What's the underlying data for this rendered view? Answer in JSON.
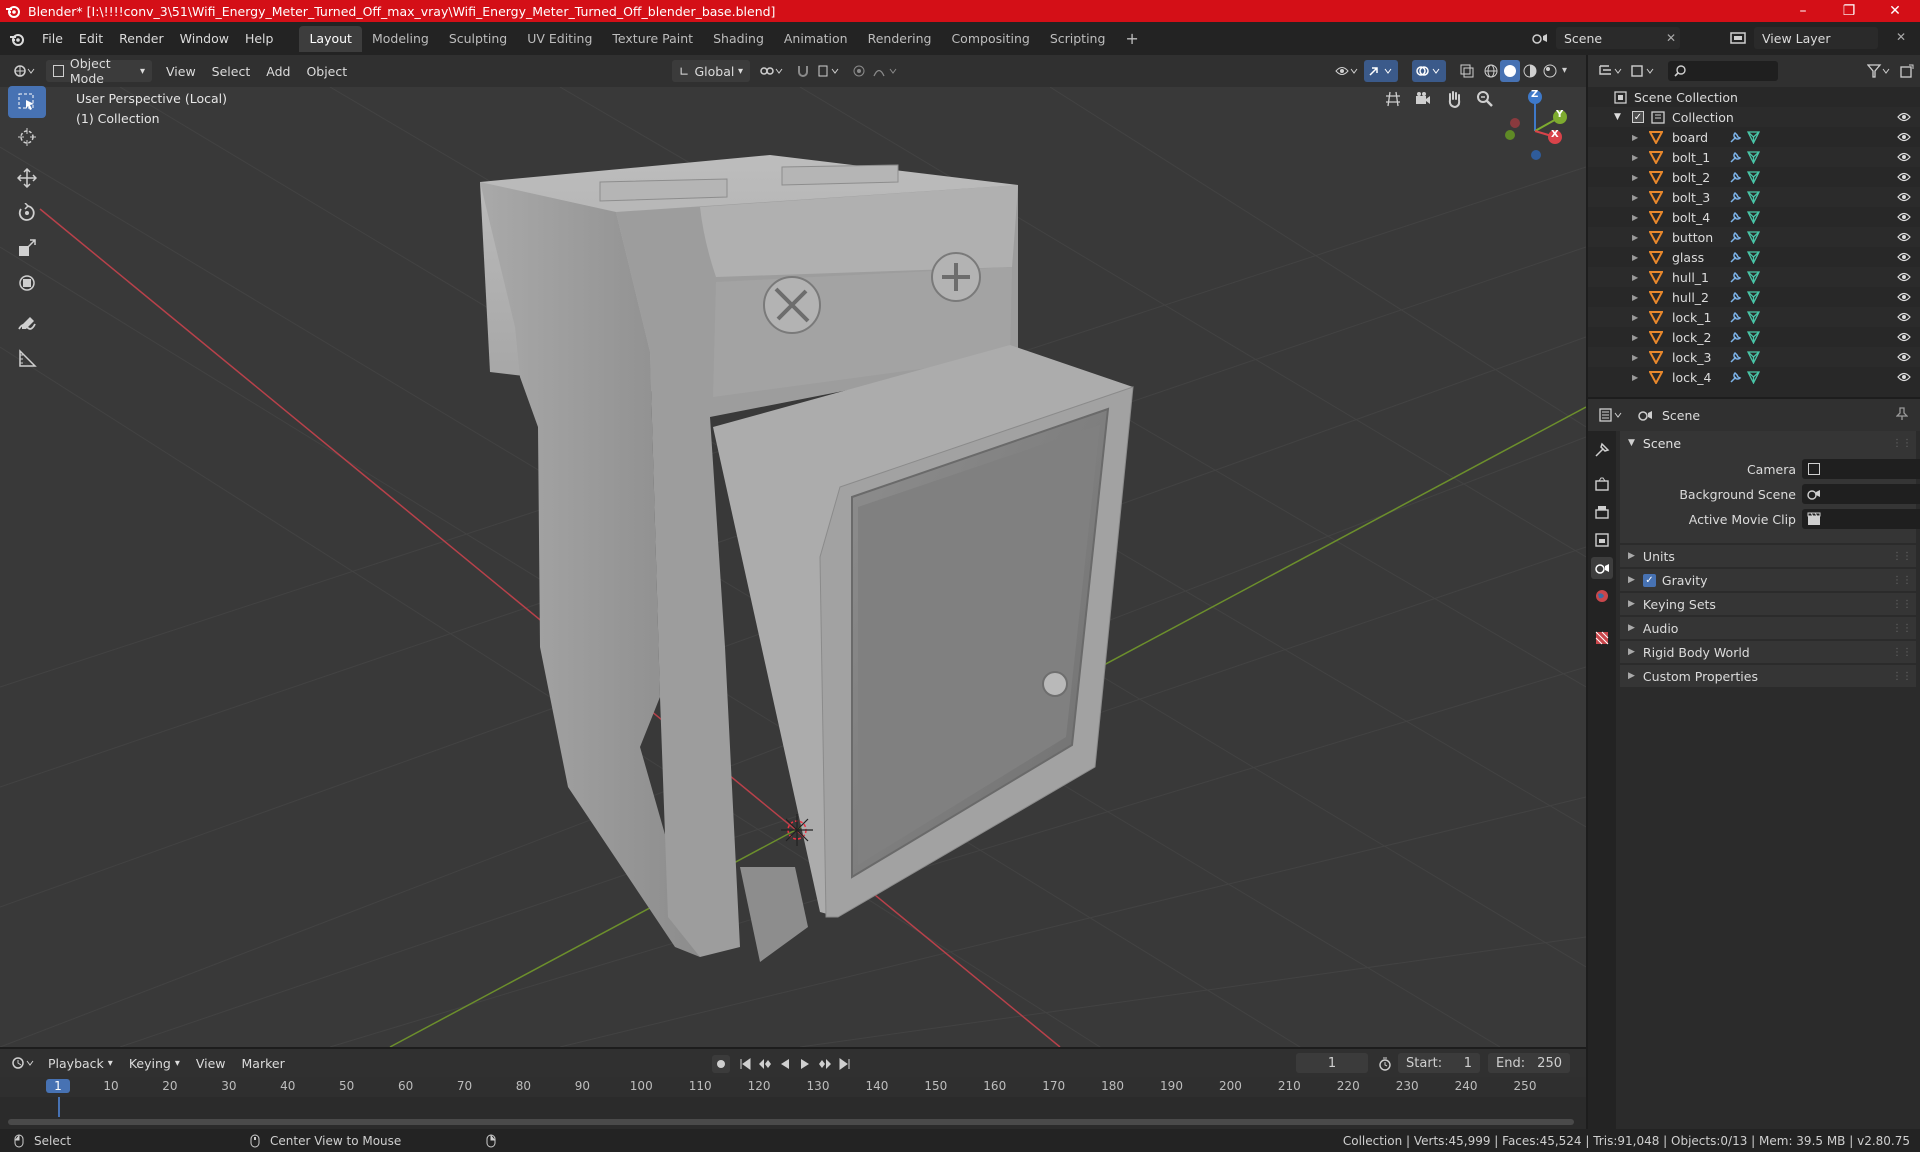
{
  "window": {
    "title": "Blender* [I:\\!!!!conv_3\\51\\Wifi_Energy_Meter_Turned_Off_max_vray\\Wifi_Energy_Meter_Turned_Off_blender_base.blend]"
  },
  "menu": [
    "File",
    "Edit",
    "Render",
    "Window",
    "Help"
  ],
  "workspaces": [
    "Layout",
    "Modeling",
    "Sculpting",
    "UV Editing",
    "Texture Paint",
    "Shading",
    "Animation",
    "Rendering",
    "Compositing",
    "Scripting"
  ],
  "scene_selector": "Scene",
  "view_layer_selector": "View Layer",
  "viewport_header": {
    "mode": "Object Mode",
    "menus": [
      "View",
      "Select",
      "Add",
      "Object"
    ],
    "transform": "Global"
  },
  "viewport": {
    "perspective_label": "User Perspective (Local)",
    "collection_label": "(1) Collection",
    "gizmo_axes": [
      "Z",
      "Y",
      "X"
    ]
  },
  "outliner": {
    "root": "Scene Collection",
    "collection": "Collection",
    "objects": [
      "board",
      "bolt_1",
      "bolt_2",
      "bolt_3",
      "bolt_4",
      "button",
      "glass",
      "hull_1",
      "hull_2",
      "lock_1",
      "lock_2",
      "lock_3",
      "lock_4"
    ]
  },
  "properties": {
    "header": "Scene",
    "panel_title": "Scene",
    "fields": [
      {
        "label": "Camera"
      },
      {
        "label": "Background Scene"
      },
      {
        "label": "Active Movie Clip"
      }
    ],
    "subpanels": [
      {
        "label": "Units",
        "checkbox": false
      },
      {
        "label": "Gravity",
        "checkbox": true
      },
      {
        "label": "Keying Sets",
        "checkbox": false
      },
      {
        "label": "Audio",
        "checkbox": false
      },
      {
        "label": "Rigid Body World",
        "checkbox": false
      },
      {
        "label": "Custom Properties",
        "checkbox": false
      }
    ]
  },
  "timeline": {
    "menus": [
      "Playback",
      "Keying",
      "View",
      "Marker"
    ],
    "current_frame": "1",
    "start_label": "Start:",
    "start": "1",
    "end_label": "End:",
    "end": "250",
    "ruler": [
      "1",
      "10",
      "20",
      "30",
      "40",
      "50",
      "60",
      "70",
      "80",
      "90",
      "100",
      "110",
      "120",
      "130",
      "140",
      "150",
      "160",
      "170",
      "180",
      "190",
      "200",
      "210",
      "220",
      "230",
      "240",
      "250"
    ]
  },
  "statusbar": {
    "select": "Select",
    "center": "Center View to Mouse",
    "stats": "Collection | Verts:45,999 | Faces:45,524 | Tris:91,048 | Objects:0/13 | Mem: 39.5 MB | v2.80.75"
  },
  "colors": {
    "title_bar": "#d40f17",
    "active_tool": "#4772b3",
    "x_axis": "#d9434a",
    "y_axis": "#7eab30",
    "z_axis": "#3e79c9",
    "object_icon": "#e8882c",
    "mesh_icon": "#49c4a6"
  }
}
